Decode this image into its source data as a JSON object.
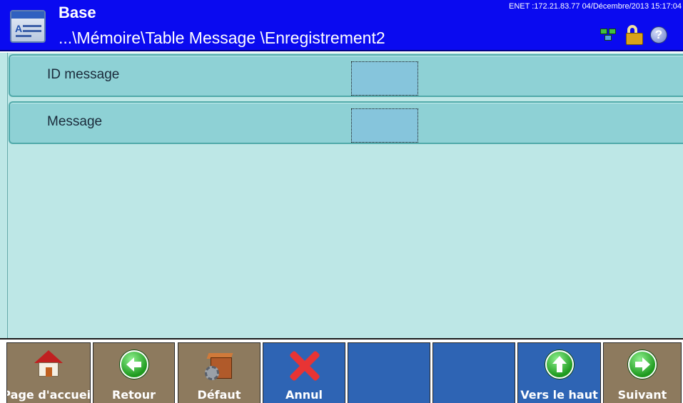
{
  "header": {
    "title": "Base",
    "path": "...\\Mémoire\\Table Message \\Enregistrement2",
    "status": "ENET :172.21.83.77  04/Décembre/2013 15:17:04",
    "icons": [
      "document-icon",
      "network-icon",
      "lock-open-icon",
      "help-icon"
    ]
  },
  "fields": [
    {
      "label": "ID message",
      "value": ""
    },
    {
      "label": "Message",
      "value": ""
    }
  ],
  "toolbar": {
    "keys": [
      {
        "label": "Page d'accueil",
        "icon": "home-icon"
      },
      {
        "label": "Retour",
        "icon": "arrow-left-icon"
      },
      {
        "label": "Défaut",
        "icon": "box-gear-icon"
      },
      {
        "label": "Annul",
        "icon": "cancel-x-icon"
      },
      {
        "label": "",
        "icon": ""
      },
      {
        "label": "",
        "icon": ""
      },
      {
        "label": "Vers le haut",
        "icon": "arrow-up-icon"
      },
      {
        "label": "Suivant",
        "icon": "arrow-right-icon"
      }
    ]
  },
  "colors": {
    "header_bg": "#0a0af0",
    "content_bg": "#bde7e6",
    "field_bg": "#8ed1d5",
    "softkey_brown": "#8d7a5e",
    "softkey_blue": "#2e64b4",
    "icon_green": "#1e9a1e",
    "cancel_red": "#e83434"
  }
}
